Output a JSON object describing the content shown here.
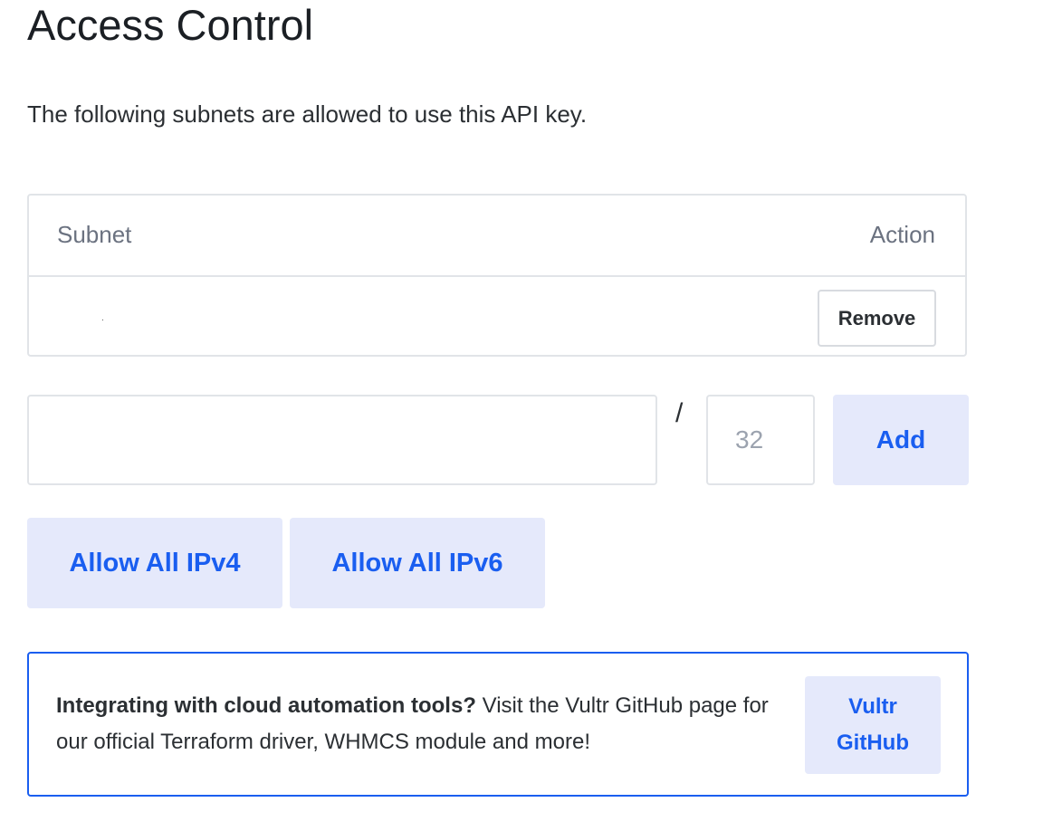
{
  "page": {
    "title": "Access Control",
    "intro": "The following subnets are allowed to use this API key."
  },
  "subnet_table": {
    "columns": [
      "Subnet",
      "Action"
    ],
    "rows": [
      {
        "subnet": ".",
        "action_label": "Remove"
      }
    ]
  },
  "add_form": {
    "ip_value": "",
    "separator": "/",
    "mask_placeholder": "32",
    "add_label": "Add"
  },
  "quick_actions": {
    "allow_ipv4_label": "Allow All IPv4",
    "allow_ipv6_label": "Allow All IPv6"
  },
  "promo": {
    "bold_text": "Integrating with cloud automation tools?",
    "body_text": " Visit the Vultr GitHub page for our official Terraform driver, WHMCS module and more!",
    "button_line1": "Vultr",
    "button_line2": "GitHub"
  },
  "colors": {
    "accent": "#1a5ef0",
    "soft_button_bg": "#e5e9fb",
    "border": "#e1e4e8"
  }
}
